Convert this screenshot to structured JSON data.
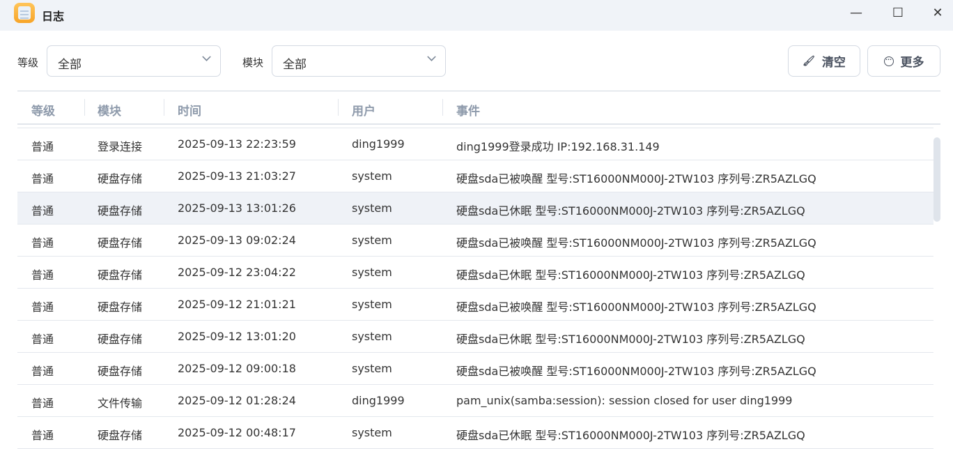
{
  "window": {
    "title": "日志"
  },
  "filters": {
    "level_label": "等级",
    "level_value": "全部",
    "module_label": "模块",
    "module_value": "全部"
  },
  "toolbar": {
    "clear_label": "清空",
    "more_label": "更多"
  },
  "table": {
    "headers": [
      "等级",
      "模块",
      "时间",
      "用户",
      "事件"
    ],
    "rows": [
      [
        "普通",
        "登录连接",
        "2025-09-13 22:23:59",
        "ding1999",
        "ding1999登录成功 IP:192.168.31.149"
      ],
      [
        "普通",
        "硬盘存储",
        "2025-09-13 21:03:27",
        "system",
        "硬盘sda已被唤醒 型号:ST16000NM000J-2TW103 序列号:ZR5AZLGQ"
      ],
      [
        "普通",
        "硬盘存储",
        "2025-09-13 13:01:26",
        "system",
        "硬盘sda已休眠 型号:ST16000NM000J-2TW103 序列号:ZR5AZLGQ"
      ],
      [
        "普通",
        "硬盘存储",
        "2025-09-13 09:02:24",
        "system",
        "硬盘sda已被唤醒 型号:ST16000NM000J-2TW103 序列号:ZR5AZLGQ"
      ],
      [
        "普通",
        "硬盘存储",
        "2025-09-12 23:04:22",
        "system",
        "硬盘sda已休眠 型号:ST16000NM000J-2TW103 序列号:ZR5AZLGQ"
      ],
      [
        "普通",
        "硬盘存储",
        "2025-09-12 21:01:21",
        "system",
        "硬盘sda已被唤醒 型号:ST16000NM000J-2TW103 序列号:ZR5AZLGQ"
      ],
      [
        "普通",
        "硬盘存储",
        "2025-09-12 13:01:20",
        "system",
        "硬盘sda已休眠 型号:ST16000NM000J-2TW103 序列号:ZR5AZLGQ"
      ],
      [
        "普通",
        "硬盘存储",
        "2025-09-12 09:00:18",
        "system",
        "硬盘sda已被唤醒 型号:ST16000NM000J-2TW103 序列号:ZR5AZLGQ"
      ],
      [
        "普通",
        "文件传输",
        "2025-09-12 01:28:24",
        "ding1999",
        "pam_unix(samba:session): session closed for user ding1999"
      ],
      [
        "普通",
        "硬盘存储",
        "2025-09-12 00:48:17",
        "system",
        "硬盘sda已休眠 型号:ST16000NM000J-2TW103 序列号:ZR5AZLGQ"
      ]
    ]
  }
}
